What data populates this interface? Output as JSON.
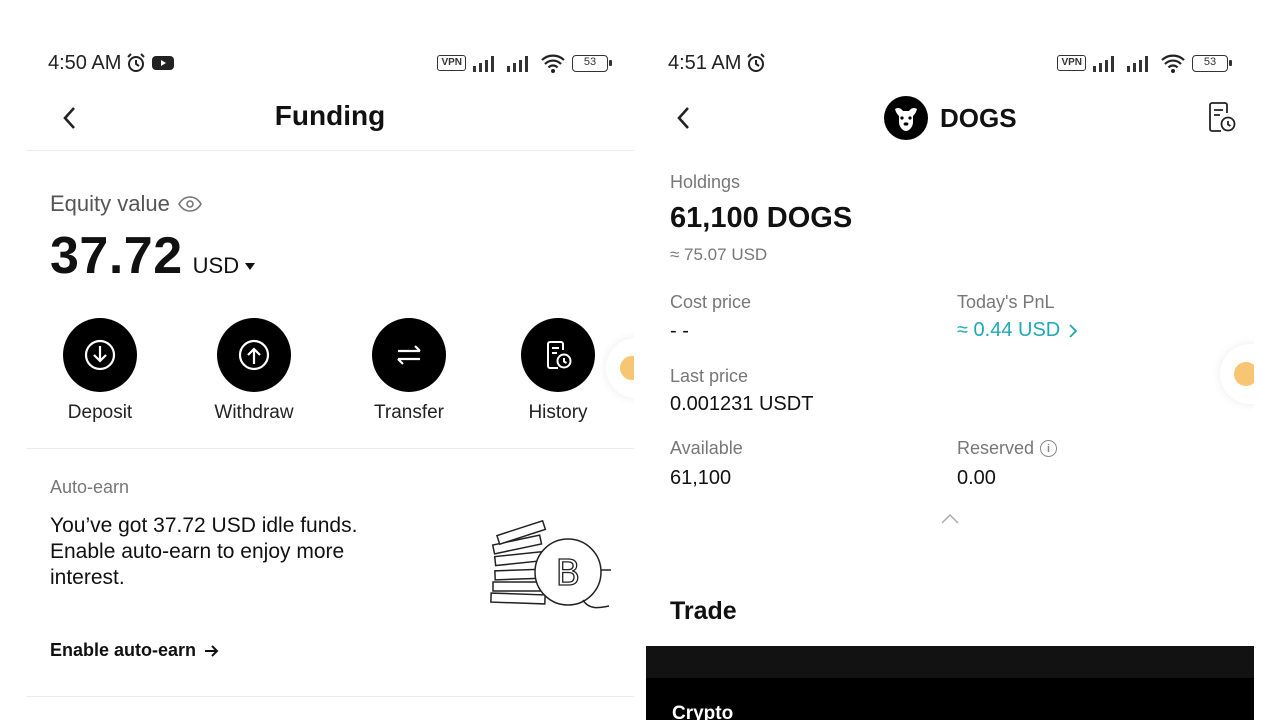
{
  "left": {
    "status": {
      "time": "4:50 AM",
      "vpn": "VPN",
      "battery": "53"
    },
    "title": "Funding",
    "equity": {
      "label": "Equity value",
      "value": "37.72",
      "currency": "USD"
    },
    "actions": [
      {
        "label": "Deposit",
        "icon": "deposit-icon"
      },
      {
        "label": "Withdraw",
        "icon": "withdraw-icon"
      },
      {
        "label": "Transfer",
        "icon": "transfer-icon"
      },
      {
        "label": "History",
        "icon": "history-icon"
      }
    ],
    "auto_earn": {
      "label": "Auto-earn",
      "line1": "You’ve got 37.72 USD idle funds.",
      "line2": "Enable auto-earn to enjoy more",
      "line3": "interest.",
      "link": "Enable auto-earn"
    }
  },
  "right": {
    "status": {
      "time": "4:51 AM",
      "vpn": "VPN",
      "battery": "53"
    },
    "title": "DOGS",
    "holdings": {
      "label": "Holdings",
      "value": "61,100 DOGS",
      "approx": "≈ 75.07 USD"
    },
    "cost_price": {
      "label": "Cost price",
      "value": "- -"
    },
    "todays_pnl": {
      "label": "Today's PnL",
      "value": "≈ 0.44 USD"
    },
    "last_price": {
      "label": "Last price",
      "value": "0.001231 USDT"
    },
    "available": {
      "label": "Available",
      "value": "61,100"
    },
    "reserved": {
      "label": "Reserved",
      "value": "0.00"
    },
    "trade_title": "Trade",
    "panel_label": "Crypto"
  },
  "colors": {
    "accent": "#1fa9b3",
    "button_bg": "#000000",
    "coin": "#f8c672"
  }
}
